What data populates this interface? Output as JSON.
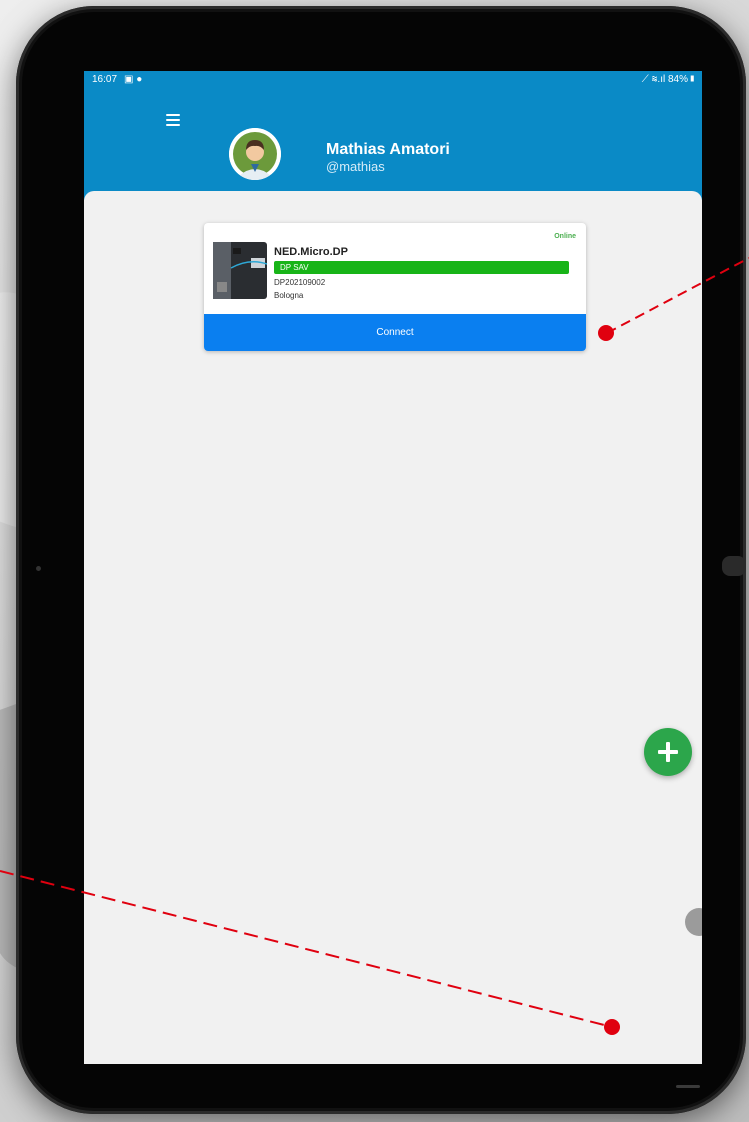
{
  "status_bar": {
    "time": "16:07",
    "left_icons": "▣ ●",
    "right_icons": "⟋ ≋.ıl 84%▮"
  },
  "header": {
    "menu_icon": "hamburger-menu-icon",
    "user": {
      "name": "Mathias Amatori",
      "handle": "@mathias"
    }
  },
  "device_card": {
    "status": "Online",
    "name": "NED.Micro.DP",
    "badge": "DP SAV",
    "serial": "DP202109002",
    "location": "Bologna",
    "connect_label": "Connect"
  },
  "colors": {
    "header": "#0a8ac6",
    "badge": "#18b418",
    "connect": "#0a7ff0",
    "add_fab": "#2ca64b",
    "annotation": "#e0000f"
  }
}
